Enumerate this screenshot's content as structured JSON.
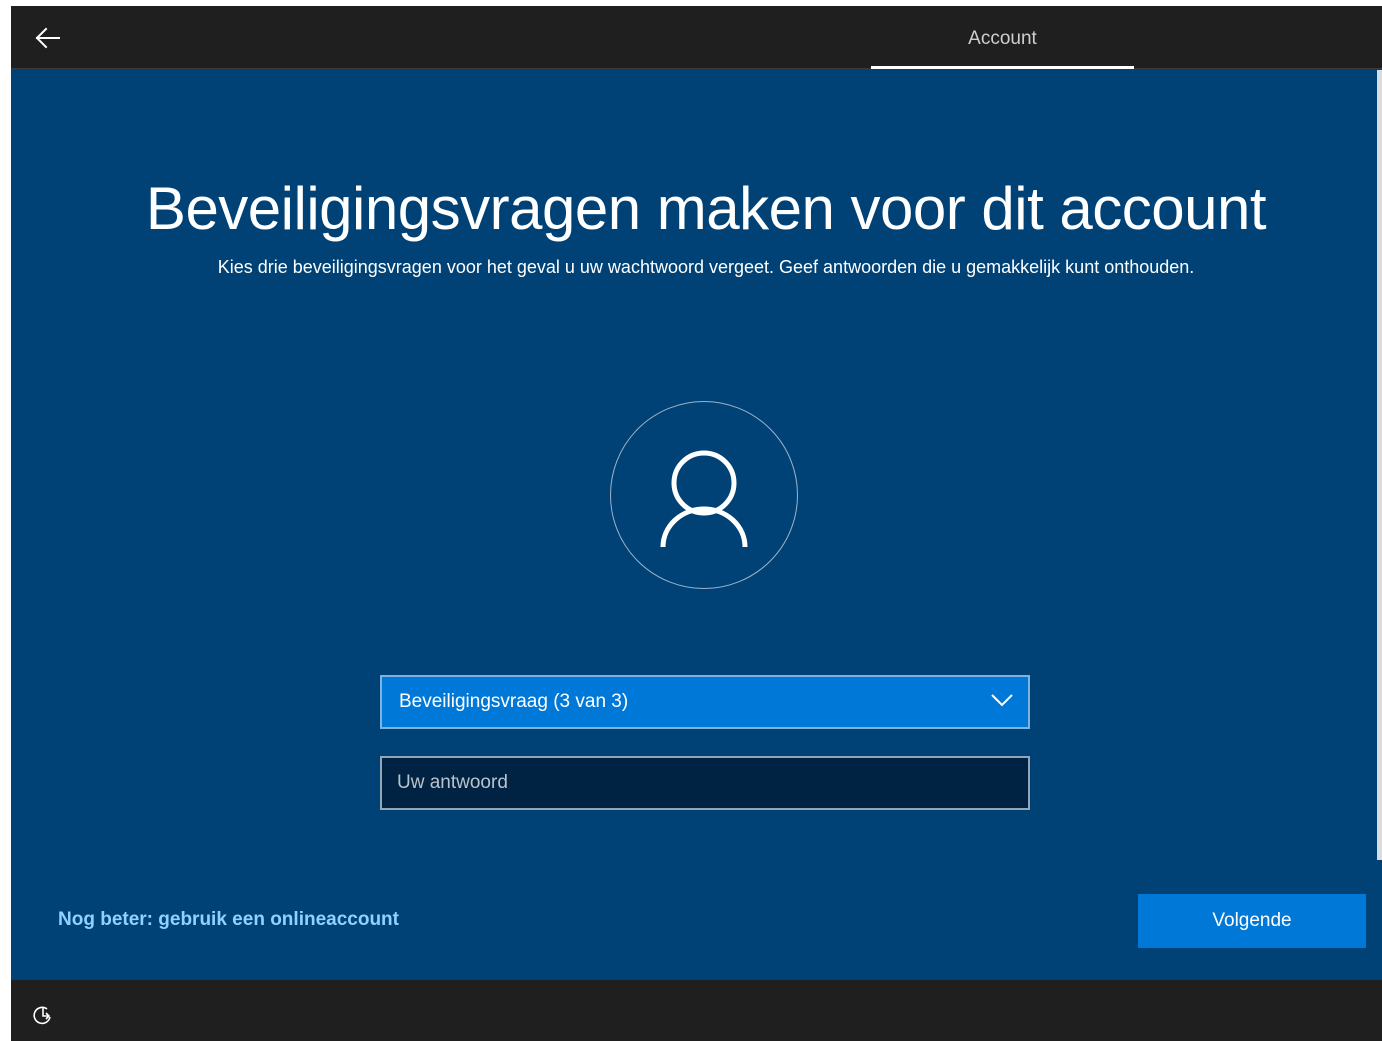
{
  "header": {
    "back_icon": "arrow-left-icon",
    "tab_label": "Account"
  },
  "main": {
    "title": "Beveiligingsvragen maken voor dit account",
    "subtitle": "Kies drie beveiligingsvragen voor het geval u uw wachtwoord vergeet. Geef antwoorden die u gemakkelijk kunt onthouden.",
    "avatar_icon": "user-icon",
    "question_dropdown": {
      "selected": "Beveiligingsvraag (3 van 3)",
      "icon": "chevron-down-icon"
    },
    "answer_field": {
      "value": "",
      "placeholder": "Uw antwoord"
    }
  },
  "footer": {
    "online_account_link": "Nog beter: gebruik een onlineaccount",
    "next_button": "Volgende",
    "ease_of_access_icon": "ease-of-access-icon"
  },
  "colors": {
    "background": "#004275",
    "bar": "#1f1f1f",
    "accent": "#0078d7",
    "input_background": "#002343",
    "link": "#8fd1ff"
  }
}
